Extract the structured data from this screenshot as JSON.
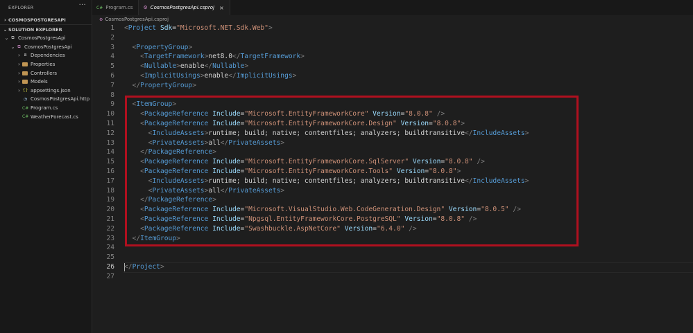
{
  "sidebar": {
    "title": "EXPLORER",
    "more": "···",
    "workspace_section": "COSMOSPOSTGRESAPI",
    "solution_section": "SOLUTION EXPLORER",
    "tree": [
      {
        "label": "CosmosPostgresApi",
        "icon": "solution-icon",
        "chevron": "⌄",
        "indent": 0
      },
      {
        "label": "CosmosPostgresApi",
        "icon": "project-icon",
        "chevron": "⌄",
        "indent": 1
      },
      {
        "label": "Dependencies",
        "icon": "dependencies-icon",
        "chevron": "›",
        "indent": 2
      },
      {
        "label": "Properties",
        "icon": "folder-icon",
        "chevron": "›",
        "indent": 2
      },
      {
        "label": "Controllers",
        "icon": "folder-icon",
        "chevron": "›",
        "indent": 2
      },
      {
        "label": "Models",
        "icon": "folder-icon",
        "chevron": "›",
        "indent": 2
      },
      {
        "label": "appsettings.json",
        "icon": "json-icon",
        "chevron": "›",
        "indent": 2
      },
      {
        "label": "CosmosPostgresApi.http",
        "icon": "http-icon",
        "chevron": "",
        "indent": 2
      },
      {
        "label": "Program.cs",
        "icon": "csharp-icon",
        "chevron": "",
        "indent": 2
      },
      {
        "label": "WeatherForecast.cs",
        "icon": "csharp-icon",
        "chevron": "",
        "indent": 2
      }
    ]
  },
  "tabs": [
    {
      "label": "Program.cs",
      "icon_text": "C#",
      "active": false
    },
    {
      "label": "CosmosPostgresApi.csproj",
      "icon_text": "⚙",
      "active": true,
      "close": "×"
    }
  ],
  "breadcrumb": "CosmosPostgresApi.csproj",
  "editor": {
    "current_line": 26,
    "lines": [
      [
        [
          "p",
          "<"
        ],
        [
          "tag",
          "Project"
        ],
        [
          "txt",
          " "
        ],
        [
          "attr",
          "Sdk"
        ],
        [
          "txt",
          "="
        ],
        [
          "str",
          "\"Microsoft.NET.Sdk.Web\""
        ],
        [
          "p",
          ">"
        ]
      ],
      [],
      [
        [
          "txt",
          "  "
        ],
        [
          "p",
          "<"
        ],
        [
          "tag",
          "PropertyGroup"
        ],
        [
          "p",
          ">"
        ]
      ],
      [
        [
          "txt",
          "    "
        ],
        [
          "p",
          "<"
        ],
        [
          "tag",
          "TargetFramework"
        ],
        [
          "p",
          ">"
        ],
        [
          "txt",
          "net8.0"
        ],
        [
          "p",
          "</"
        ],
        [
          "tag",
          "TargetFramework"
        ],
        [
          "p",
          ">"
        ]
      ],
      [
        [
          "txt",
          "    "
        ],
        [
          "p",
          "<"
        ],
        [
          "tag",
          "Nullable"
        ],
        [
          "p",
          ">"
        ],
        [
          "txt",
          "enable"
        ],
        [
          "p",
          "</"
        ],
        [
          "tag",
          "Nullable"
        ],
        [
          "p",
          ">"
        ]
      ],
      [
        [
          "txt",
          "    "
        ],
        [
          "p",
          "<"
        ],
        [
          "tag",
          "ImplicitUsings"
        ],
        [
          "p",
          ">"
        ],
        [
          "txt",
          "enable"
        ],
        [
          "p",
          "</"
        ],
        [
          "tag",
          "ImplicitUsings"
        ],
        [
          "p",
          ">"
        ]
      ],
      [
        [
          "txt",
          "  "
        ],
        [
          "p",
          "</"
        ],
        [
          "tag",
          "PropertyGroup"
        ],
        [
          "p",
          ">"
        ]
      ],
      [],
      [
        [
          "txt",
          "  "
        ],
        [
          "p",
          "<"
        ],
        [
          "tag",
          "ItemGroup"
        ],
        [
          "p",
          ">"
        ]
      ],
      [
        [
          "txt",
          "    "
        ],
        [
          "p",
          "<"
        ],
        [
          "tag",
          "PackageReference"
        ],
        [
          "txt",
          " "
        ],
        [
          "attr",
          "Include"
        ],
        [
          "txt",
          "="
        ],
        [
          "str",
          "\"Microsoft.EntityFrameworkCore\""
        ],
        [
          "txt",
          " "
        ],
        [
          "attr",
          "Version"
        ],
        [
          "txt",
          "="
        ],
        [
          "str",
          "\"8.0.8\""
        ],
        [
          "txt",
          " "
        ],
        [
          "p",
          "/>"
        ]
      ],
      [
        [
          "txt",
          "    "
        ],
        [
          "p",
          "<"
        ],
        [
          "tag",
          "PackageReference"
        ],
        [
          "txt",
          " "
        ],
        [
          "attr",
          "Include"
        ],
        [
          "txt",
          "="
        ],
        [
          "str",
          "\"Microsoft.EntityFrameworkCore.Design\""
        ],
        [
          "txt",
          " "
        ],
        [
          "attr",
          "Version"
        ],
        [
          "txt",
          "="
        ],
        [
          "str",
          "\"8.0.8\""
        ],
        [
          "p",
          ">"
        ]
      ],
      [
        [
          "txt",
          "      "
        ],
        [
          "p",
          "<"
        ],
        [
          "tag",
          "IncludeAssets"
        ],
        [
          "p",
          ">"
        ],
        [
          "txt",
          "runtime; build; native; contentfiles; analyzers; buildtransitive"
        ],
        [
          "p",
          "</"
        ],
        [
          "tag",
          "IncludeAssets"
        ],
        [
          "p",
          ">"
        ]
      ],
      [
        [
          "txt",
          "      "
        ],
        [
          "p",
          "<"
        ],
        [
          "tag",
          "PrivateAssets"
        ],
        [
          "p",
          ">"
        ],
        [
          "txt",
          "all"
        ],
        [
          "p",
          "</"
        ],
        [
          "tag",
          "PrivateAssets"
        ],
        [
          "p",
          ">"
        ]
      ],
      [
        [
          "txt",
          "    "
        ],
        [
          "p",
          "</"
        ],
        [
          "tag",
          "PackageReference"
        ],
        [
          "p",
          ">"
        ]
      ],
      [
        [
          "txt",
          "    "
        ],
        [
          "p",
          "<"
        ],
        [
          "tag",
          "PackageReference"
        ],
        [
          "txt",
          " "
        ],
        [
          "attr",
          "Include"
        ],
        [
          "txt",
          "="
        ],
        [
          "str",
          "\"Microsoft.EntityFrameworkCore.SqlServer\""
        ],
        [
          "txt",
          " "
        ],
        [
          "attr",
          "Version"
        ],
        [
          "txt",
          "="
        ],
        [
          "str",
          "\"8.0.8\""
        ],
        [
          "txt",
          " "
        ],
        [
          "p",
          "/>"
        ]
      ],
      [
        [
          "txt",
          "    "
        ],
        [
          "p",
          "<"
        ],
        [
          "tag",
          "PackageReference"
        ],
        [
          "txt",
          " "
        ],
        [
          "attr",
          "Include"
        ],
        [
          "txt",
          "="
        ],
        [
          "str",
          "\"Microsoft.EntityFrameworkCore.Tools\""
        ],
        [
          "txt",
          " "
        ],
        [
          "attr",
          "Version"
        ],
        [
          "txt",
          "="
        ],
        [
          "str",
          "\"8.0.8\""
        ],
        [
          "p",
          ">"
        ]
      ],
      [
        [
          "txt",
          "      "
        ],
        [
          "p",
          "<"
        ],
        [
          "tag",
          "IncludeAssets"
        ],
        [
          "p",
          ">"
        ],
        [
          "txt",
          "runtime; build; native; contentfiles; analyzers; buildtransitive"
        ],
        [
          "p",
          "</"
        ],
        [
          "tag",
          "IncludeAssets"
        ],
        [
          "p",
          ">"
        ]
      ],
      [
        [
          "txt",
          "      "
        ],
        [
          "p",
          "<"
        ],
        [
          "tag",
          "PrivateAssets"
        ],
        [
          "p",
          ">"
        ],
        [
          "txt",
          "all"
        ],
        [
          "p",
          "</"
        ],
        [
          "tag",
          "PrivateAssets"
        ],
        [
          "p",
          ">"
        ]
      ],
      [
        [
          "txt",
          "    "
        ],
        [
          "p",
          "</"
        ],
        [
          "tag",
          "PackageReference"
        ],
        [
          "p",
          ">"
        ]
      ],
      [
        [
          "txt",
          "    "
        ],
        [
          "p",
          "<"
        ],
        [
          "tag",
          "PackageReference"
        ],
        [
          "txt",
          " "
        ],
        [
          "attr",
          "Include"
        ],
        [
          "txt",
          "="
        ],
        [
          "str",
          "\"Microsoft.VisualStudio.Web.CodeGeneration.Design\""
        ],
        [
          "txt",
          " "
        ],
        [
          "attr",
          "Version"
        ],
        [
          "txt",
          "="
        ],
        [
          "str",
          "\"8.0.5\""
        ],
        [
          "txt",
          " "
        ],
        [
          "p",
          "/>"
        ]
      ],
      [
        [
          "txt",
          "    "
        ],
        [
          "p",
          "<"
        ],
        [
          "tag",
          "PackageReference"
        ],
        [
          "txt",
          " "
        ],
        [
          "attr",
          "Include"
        ],
        [
          "txt",
          "="
        ],
        [
          "str",
          "\"Npgsql.EntityFrameworkCore.PostgreSQL\""
        ],
        [
          "txt",
          " "
        ],
        [
          "attr",
          "Version"
        ],
        [
          "txt",
          "="
        ],
        [
          "str",
          "\"8.0.8\""
        ],
        [
          "txt",
          " "
        ],
        [
          "p",
          "/>"
        ]
      ],
      [
        [
          "txt",
          "    "
        ],
        [
          "p",
          "<"
        ],
        [
          "tag",
          "PackageReference"
        ],
        [
          "txt",
          " "
        ],
        [
          "attr",
          "Include"
        ],
        [
          "txt",
          "="
        ],
        [
          "str",
          "\"Swashbuckle.AspNetCore\""
        ],
        [
          "txt",
          " "
        ],
        [
          "attr",
          "Version"
        ],
        [
          "txt",
          "="
        ],
        [
          "str",
          "\"6.4.0\""
        ],
        [
          "txt",
          " "
        ],
        [
          "p",
          "/>"
        ]
      ],
      [
        [
          "txt",
          "  "
        ],
        [
          "p",
          "</"
        ],
        [
          "tag",
          "ItemGroup"
        ],
        [
          "p",
          ">"
        ]
      ],
      [],
      [],
      [
        [
          "p",
          "</"
        ],
        [
          "tag",
          "Project"
        ],
        [
          "p",
          ">"
        ]
      ],
      []
    ]
  },
  "colors": {
    "highlight_border": "#b0101f",
    "tag": "#569cd6",
    "attribute": "#9cdcfe",
    "string": "#ce9178",
    "text": "#d4d4d4",
    "punctuation": "#808080"
  }
}
